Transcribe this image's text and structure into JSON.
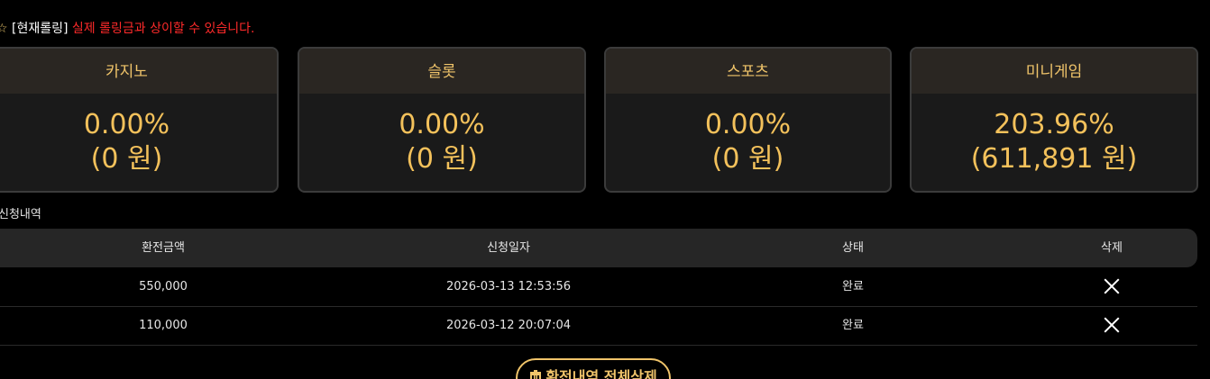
{
  "notice": {
    "star": "☆",
    "tag": "[현재롤링]",
    "warning": "실제 롤링금과 상이할 수 있습니다."
  },
  "rolling_cards": [
    {
      "name": "카지노",
      "percent": "0.00%",
      "amount": "(0 원)"
    },
    {
      "name": "슬롯",
      "percent": "0.00%",
      "amount": "(0 원)"
    },
    {
      "name": "스포츠",
      "percent": "0.00%",
      "amount": "(0 원)"
    },
    {
      "name": "미니게임",
      "percent": "203.96%",
      "amount": "(611,891 원)"
    }
  ],
  "history": {
    "title": "신청내역",
    "headers": [
      "환전금액",
      "신청일자",
      "상태",
      "삭제"
    ],
    "rows": [
      {
        "amount": "550,000",
        "date": "2026-03-13 12:53:56",
        "status": "완료"
      },
      {
        "amount": "110,000",
        "date": "2026-03-12 20:07:04",
        "status": "완료"
      }
    ]
  },
  "delete_all_label": "환전내역 전체삭제",
  "colors": {
    "accent": "#f0c46a",
    "warning": "#ff2a2a",
    "background": "#000000"
  }
}
